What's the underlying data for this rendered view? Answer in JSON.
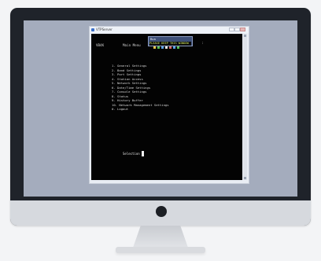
{
  "window": {
    "title": "VTPServer",
    "controls": [
      "minimize",
      "maximize",
      "close"
    ]
  },
  "terminal": {
    "header_left": "VB4K",
    "header_mid": "Main Menu",
    "status_top": "Run",
    "status_bottom": "PLEASE KEEP THIS WINDOW",
    "cursor_mark": ":",
    "menu_items": [
      "1. General Settings",
      "2. Band Settings",
      "3. Port Settings",
      "4. Station Access",
      "5. Network Settings",
      "6. Date/Time Settings",
      "7. Console Settings",
      "8. Status",
      "9. History Buffer",
      "10. Network Management Settings",
      "0. Logout"
    ],
    "prompt": "Selection"
  },
  "colors": {
    "screen_bg": "#a4acbd",
    "terminal_bg": "#030303",
    "terminal_text": "#d7d7d7",
    "status_text": "#d8f060"
  }
}
